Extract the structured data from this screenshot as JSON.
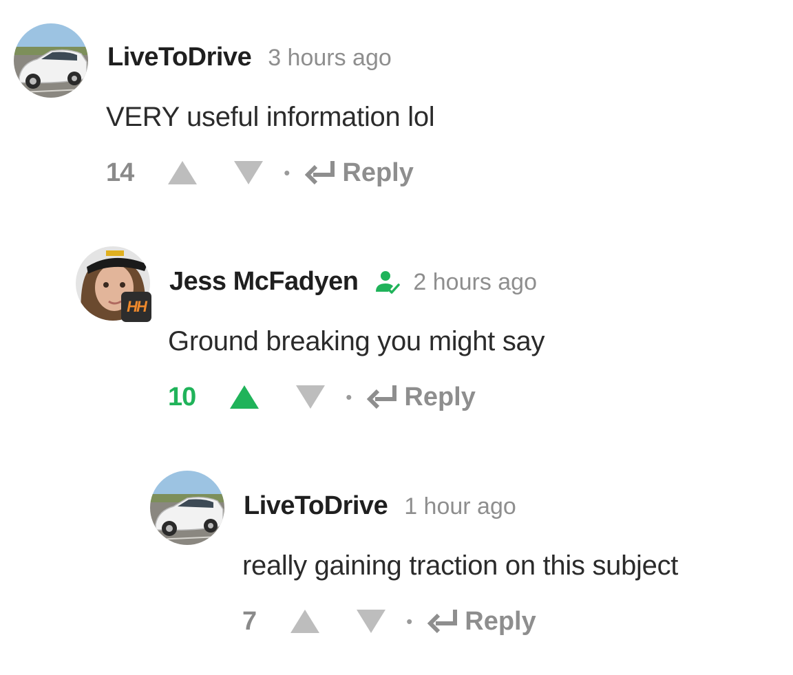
{
  "comments": [
    {
      "author": "LiveToDrive",
      "time": "3 hours ago",
      "text": "VERY useful information lol",
      "score": "14",
      "reply_label": "Reply",
      "voted": "none",
      "verified": false
    },
    {
      "author": "Jess McFadyen",
      "time": "2 hours ago",
      "text": "Ground breaking you might say",
      "score": "10",
      "reply_label": "Reply",
      "voted": "up",
      "verified": true,
      "badge_text": "HH"
    },
    {
      "author": "LiveToDrive",
      "time": "1 hour ago",
      "text": "really gaining traction on this subject",
      "score": "7",
      "reply_label": "Reply",
      "voted": "none",
      "verified": false
    }
  ],
  "colors": {
    "upvoted": "#20b35a",
    "arrow_neutral": "#bdbdbd",
    "muted_text": "#8e8e8e",
    "badge_bg": "#2d2d2d",
    "badge_text": "#f08a2c"
  },
  "icons": {
    "upvote": "triangle-up-icon",
    "downvote": "triangle-down-icon",
    "reply": "reply-arrow-icon",
    "verified": "verified-user-icon"
  }
}
